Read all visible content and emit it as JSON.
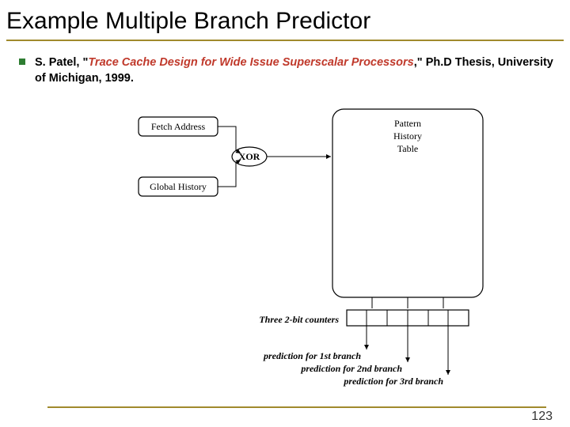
{
  "title": "Example Multiple Branch Predictor",
  "citation": {
    "author": "S. Patel, \"",
    "work_title": "Trace Cache Design for Wide Issue Superscalar Processors",
    "rest": ",\" Ph.D Thesis, University of Michigan, 1999."
  },
  "diagram": {
    "fetch_address": "Fetch Address",
    "global_history": "Global History",
    "xor_label": "XOR",
    "pht_line1": "Pattern",
    "pht_line2": "History",
    "pht_line3": "Table",
    "counters_label": "Three 2-bit counters",
    "pred1": "prediction for 1st branch",
    "pred2": "prediction for 2nd branch",
    "pred3": "prediction for 3rd branch"
  },
  "page_number": "123"
}
